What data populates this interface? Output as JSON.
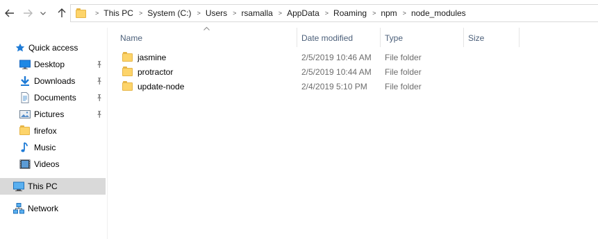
{
  "address": {
    "crumbs": [
      "This PC",
      "System (C:)",
      "Users",
      "rsamalla",
      "AppData",
      "Roaming",
      "npm",
      "node_modules"
    ]
  },
  "nav": {
    "quick_access": "Quick access",
    "items": [
      {
        "label": "Desktop",
        "icon": "desktop-icon",
        "pinned": true
      },
      {
        "label": "Downloads",
        "icon": "downloads-icon",
        "pinned": true
      },
      {
        "label": "Documents",
        "icon": "documents-icon",
        "pinned": true
      },
      {
        "label": "Pictures",
        "icon": "pictures-icon",
        "pinned": true
      },
      {
        "label": "firefox",
        "icon": "folder-icon",
        "pinned": false
      },
      {
        "label": "Music",
        "icon": "music-icon",
        "pinned": false
      },
      {
        "label": "Videos",
        "icon": "videos-icon",
        "pinned": false
      }
    ],
    "this_pc": "This PC",
    "network": "Network"
  },
  "columns": {
    "name": "Name",
    "date_modified": "Date modified",
    "type": "Type",
    "size": "Size"
  },
  "files": [
    {
      "name": "jasmine",
      "date": "2/5/2019 10:46 AM",
      "type": "File folder"
    },
    {
      "name": "protractor",
      "date": "2/5/2019 10:44 AM",
      "type": "File folder"
    },
    {
      "name": "update-node",
      "date": "2/4/2019 5:10 PM",
      "type": "File folder"
    }
  ],
  "colors": {
    "header_text": "#4c607a",
    "folder_yellow": "#fdd46a",
    "selection": "#d9d9d9",
    "accent_blue": "#1e7bd6"
  }
}
